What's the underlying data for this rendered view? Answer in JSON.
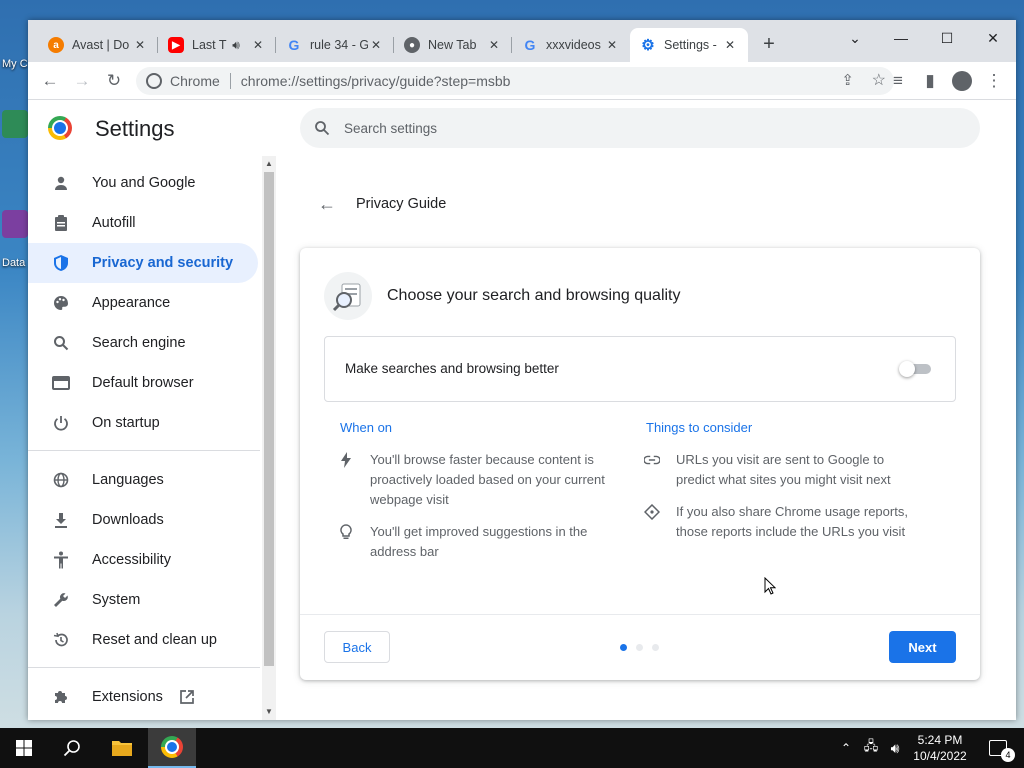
{
  "desktop": {
    "labels": [
      "My C",
      "Data"
    ]
  },
  "tabs": [
    {
      "title": "Avast | Do",
      "icon": "avast-icon",
      "color": "#f57c00"
    },
    {
      "title": "Last T",
      "icon": "youtube-icon",
      "color": "#ff0000"
    },
    {
      "title": "rule 34 - G",
      "icon": "google-icon",
      "color": "#4285f4"
    },
    {
      "title": "New Tab",
      "icon": "chrome-icon",
      "color": "#5f6368"
    },
    {
      "title": "xxxvideos",
      "icon": "google-icon",
      "color": "#4285f4"
    },
    {
      "title": "Settings -",
      "icon": "settings-gear-icon",
      "color": "#1a73e8"
    }
  ],
  "omnibox": {
    "site": "Chrome",
    "url": "chrome://settings/privacy/guide?step=msbb"
  },
  "settings": {
    "title": "Settings",
    "search_placeholder": "Search settings"
  },
  "sidebar": {
    "items": [
      {
        "label": "You and Google",
        "icon": "person-icon"
      },
      {
        "label": "Autofill",
        "icon": "clipboard-icon"
      },
      {
        "label": "Privacy and security",
        "icon": "shield-icon"
      },
      {
        "label": "Appearance",
        "icon": "palette-icon"
      },
      {
        "label": "Search engine",
        "icon": "search-icon"
      },
      {
        "label": "Default browser",
        "icon": "browser-icon"
      },
      {
        "label": "On startup",
        "icon": "power-icon"
      },
      {
        "label": "Languages",
        "icon": "globe-icon"
      },
      {
        "label": "Downloads",
        "icon": "download-icon"
      },
      {
        "label": "Accessibility",
        "icon": "accessibility-icon"
      },
      {
        "label": "System",
        "icon": "wrench-icon"
      },
      {
        "label": "Reset and clean up",
        "icon": "history-icon"
      },
      {
        "label": "Extensions",
        "icon": "puzzle-icon"
      }
    ]
  },
  "guide": {
    "page_title": "Privacy Guide",
    "heading": "Choose your search and browsing quality",
    "toggle_label": "Make searches and browsing better",
    "toggle_on": false,
    "when_on_title": "When on",
    "when_on_items": [
      "You'll browse faster because content is proactively loaded based on your current webpage visit",
      "You'll get improved suggestions in the address bar"
    ],
    "consider_title": "Things to consider",
    "consider_items": [
      "URLs you visit are sent to Google to predict what sites you might visit next",
      "If you also share Chrome usage reports, those reports include the URLs you visit"
    ],
    "back_label": "Back",
    "next_label": "Next",
    "step_current": 1,
    "step_total": 3
  },
  "taskbar": {
    "time": "5:24 PM",
    "date": "10/4/2022",
    "notifications": "4"
  },
  "colors": {
    "accent": "#1a73e8",
    "active_nav_bg": "#e8f0fe",
    "tabstrip": "#dee1e6"
  }
}
